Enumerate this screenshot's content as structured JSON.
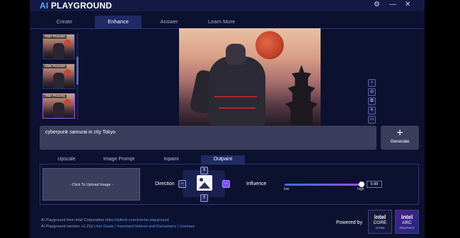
{
  "app": {
    "title_prefix": "AI",
    "title_main": "PLAYGROUND",
    "controls": {
      "settings_icon": "gear-icon",
      "minimize": "—",
      "close": "✕"
    }
  },
  "main_tabs": [
    {
      "label": "Create"
    },
    {
      "label": "Enhance",
      "active": true
    },
    {
      "label": "Answer"
    },
    {
      "label": "Learn More"
    }
  ],
  "history": {
    "items": [
      {
        "label": "After Process"
      },
      {
        "label": "After Process"
      },
      {
        "label": "After Process",
        "selected": true
      }
    ]
  },
  "tool_icons": [
    "info-icon",
    "settings-circle-icon",
    "copy-icon",
    "delete-icon",
    "folder-icon"
  ],
  "prompt": {
    "text": "cyberpunk samurai in city Tokyo"
  },
  "generate": {
    "icon": "+",
    "label": "Generate"
  },
  "sub_tabs": [
    {
      "label": "Upscale"
    },
    {
      "label": "Image Prompt"
    },
    {
      "label": "Inpaint"
    },
    {
      "label": "Outpaint",
      "active": true
    }
  ],
  "outpaint": {
    "upload_label": "- Click To Upload Image -",
    "direction_label": "Direction",
    "influence_label": "Influence",
    "influence_value": "0.99",
    "slider_fraction": 0.99,
    "low_label": "low",
    "high_label": "high",
    "direction_active": "right"
  },
  "footer": {
    "line1_text": "AI Playground from Intel Corporation ",
    "line1_link": "https://github.com/intel/ai-playground",
    "line2_text": "AI Playground version: v1.21b ",
    "line2_links": "User Guide | Important Notices and Disclaimers | Licenses",
    "powered_by": "Powered by"
  },
  "badges": {
    "core": {
      "brand": "intel",
      "name": "CORE",
      "tier": "ULTRA"
    },
    "arc": {
      "brand": "intel",
      "name": "ARC",
      "tier": "GRAPHICS"
    }
  }
}
